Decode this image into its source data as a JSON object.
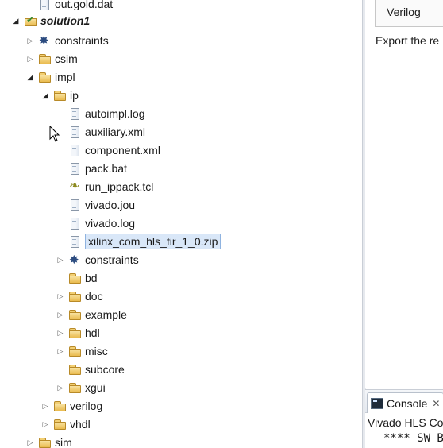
{
  "tree": {
    "items": [
      {
        "label": "out.gold.dat",
        "icon": "file-icon",
        "expander": "none"
      },
      {
        "label": "solution1",
        "icon": "solution-folder-icon",
        "expander": "expanded"
      },
      {
        "label": "constraints",
        "icon": "gear-icon",
        "expander": "collapsed"
      },
      {
        "label": "csim",
        "icon": "folder-icon",
        "expander": "collapsed"
      },
      {
        "label": "impl",
        "icon": "folder-icon",
        "expander": "expanded"
      },
      {
        "label": "ip",
        "icon": "folder-icon",
        "expander": "expanded"
      },
      {
        "label": "autoimpl.log",
        "icon": "file-icon",
        "expander": "none"
      },
      {
        "label": "auxiliary.xml",
        "icon": "file-icon",
        "expander": "none"
      },
      {
        "label": "component.xml",
        "icon": "file-icon",
        "expander": "none"
      },
      {
        "label": "pack.bat",
        "icon": "file-icon",
        "expander": "none"
      },
      {
        "label": "run_ippack.tcl",
        "icon": "tcl-script-icon",
        "expander": "none"
      },
      {
        "label": "vivado.jou",
        "icon": "file-icon",
        "expander": "none"
      },
      {
        "label": "vivado.log",
        "icon": "file-icon",
        "expander": "none"
      },
      {
        "label": "xilinx_com_hls_fir_1_0.zip",
        "icon": "file-icon",
        "expander": "none",
        "selected": true
      },
      {
        "label": "constraints",
        "icon": "gear-icon",
        "expander": "collapsed"
      },
      {
        "label": "bd",
        "icon": "folder-icon",
        "expander": "none"
      },
      {
        "label": "doc",
        "icon": "folder-icon",
        "expander": "collapsed"
      },
      {
        "label": "example",
        "icon": "folder-icon",
        "expander": "collapsed"
      },
      {
        "label": "hdl",
        "icon": "folder-icon",
        "expander": "collapsed"
      },
      {
        "label": "misc",
        "icon": "folder-icon",
        "expander": "collapsed"
      },
      {
        "label": "subcore",
        "icon": "folder-icon",
        "expander": "none"
      },
      {
        "label": "xgui",
        "icon": "folder-icon",
        "expander": "collapsed"
      },
      {
        "label": "verilog",
        "icon": "folder-icon",
        "expander": "collapsed"
      },
      {
        "label": "vhdl",
        "icon": "folder-icon",
        "expander": "collapsed"
      },
      {
        "label": "sim",
        "icon": "folder-icon",
        "expander": "collapsed"
      }
    ]
  },
  "editor": {
    "language_cell": "Verilog",
    "export_text": "Export the re"
  },
  "console": {
    "tab_label": "Console",
    "close_symbol": "✕",
    "title": "Vivado HLS Co",
    "line": "**** SW B"
  },
  "colors": {
    "selection_bg": "#d9e7f8",
    "selection_border": "#8fb3e0",
    "folder": "#e9bb4e"
  }
}
